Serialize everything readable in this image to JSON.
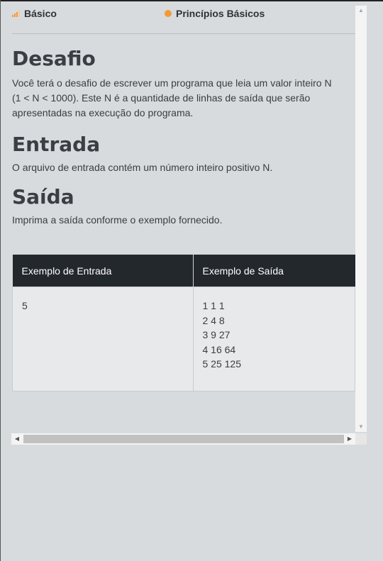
{
  "meta": {
    "level": "Básico",
    "category": "Princípios Básicos"
  },
  "sections": {
    "challenge": {
      "title": "Desafio",
      "lines": [
        "Você terá o desafio de escrever um programa que leia um valor inteiro N",
        "(1 < N < 1000). Este N é a quantidade de linhas de saída que serão",
        "apresentadas na execução do programa."
      ]
    },
    "input": {
      "title": "Entrada",
      "text": "O arquivo de entrada contém um número inteiro positivo N."
    },
    "output": {
      "title": "Saída",
      "text": "Imprima a saída conforme o exemplo fornecido."
    }
  },
  "examples": {
    "input_header": "Exemplo de Entrada",
    "output_header": "Exemplo de Saída",
    "input_lines": [
      "5"
    ],
    "output_lines": [
      "1 1 1",
      "2 4 8",
      "3 9 27",
      "4 16 64",
      "5 25 125"
    ]
  },
  "colors": {
    "accent": "#f29a3a",
    "table_header_bg": "#23282d",
    "page_bg": "#d8dbdd"
  },
  "icons": {
    "level": "signal-bars-icon",
    "category": "orange-dot-icon",
    "scroll_up": "triangle-up-icon",
    "scroll_down": "triangle-down-icon",
    "scroll_left": "triangle-left-icon",
    "scroll_right": "triangle-right-icon"
  }
}
